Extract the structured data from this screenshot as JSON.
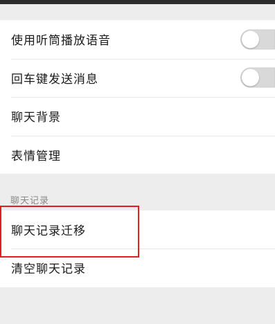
{
  "settings": {
    "group1": {
      "items": [
        {
          "label": "使用听筒播放语音",
          "toggle": "off"
        },
        {
          "label": "回车键发送消息",
          "toggle": "off"
        },
        {
          "label": "聊天背景"
        },
        {
          "label": "表情管理"
        }
      ]
    },
    "section_header": "聊天记录",
    "group2": {
      "items": [
        {
          "label": "聊天记录迁移"
        },
        {
          "label": "清空聊天记录"
        }
      ]
    }
  },
  "colors": {
    "highlight": "#e02020",
    "background": "#ededed",
    "toggle_off": "#d9d9d9"
  }
}
